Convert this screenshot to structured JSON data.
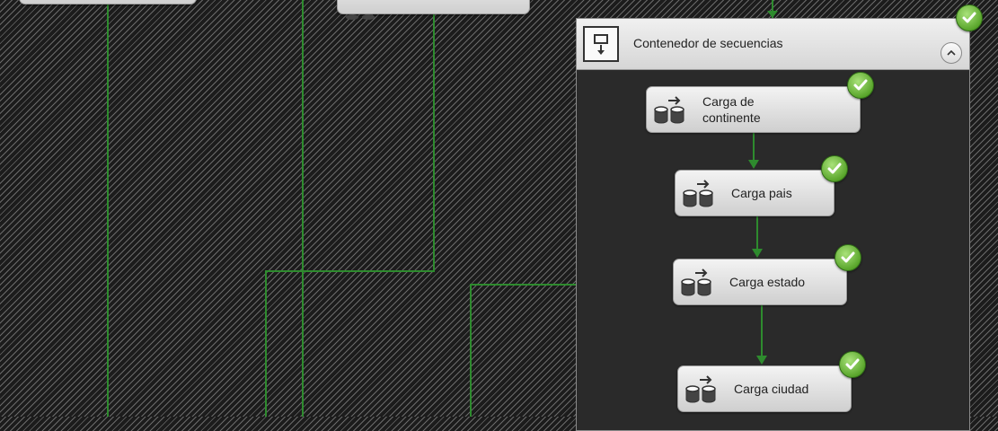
{
  "container": {
    "title": "Contenedor de secuencias",
    "status": "success",
    "collapsed": false
  },
  "tasks": [
    {
      "label": "Carga de continente",
      "status": "success"
    },
    {
      "label": "Carga pais",
      "status": "success"
    },
    {
      "label": "Carga estado",
      "status": "success"
    },
    {
      "label": "Carga ciudad",
      "status": "success"
    }
  ],
  "icons": {
    "task": "data-flow-task-icon",
    "container": "sequence-container-icon",
    "status": "success-check-icon",
    "collapse": "chevron-up-icon"
  },
  "colors": {
    "connector": "#2e8b2e",
    "success": "#5aa62c",
    "canvas_background": "#1c1c1c",
    "container_background": "#2a2a2a"
  }
}
